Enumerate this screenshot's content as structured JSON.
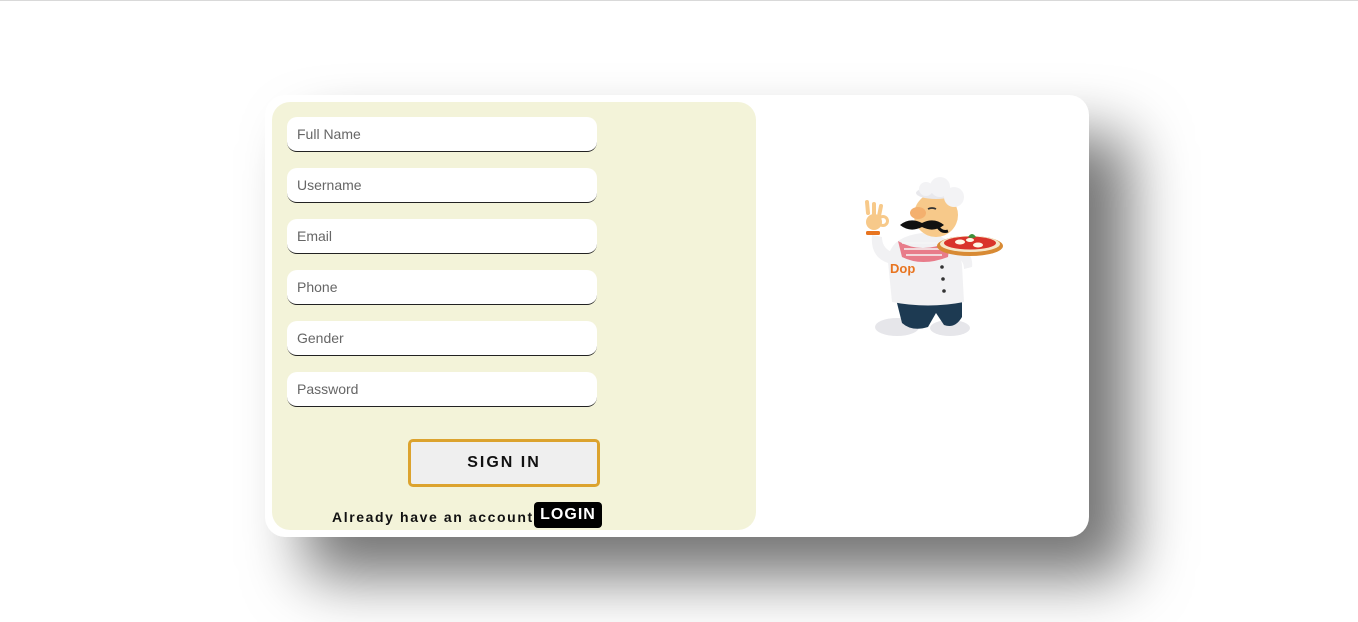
{
  "form": {
    "fields": {
      "full_name": {
        "placeholder": "Full Name",
        "value": ""
      },
      "username": {
        "placeholder": "Username",
        "value": ""
      },
      "email": {
        "placeholder": "Email",
        "value": ""
      },
      "phone": {
        "placeholder": "Phone",
        "value": ""
      },
      "gender": {
        "placeholder": "Gender",
        "value": ""
      },
      "password": {
        "placeholder": "Password",
        "value": ""
      }
    },
    "submit_label": "SIGN IN",
    "already_text": "Already have an account?",
    "login_label": "LOGIN"
  },
  "illustration": {
    "icon": "pizza-chef-illustration",
    "badge_text": "Dop"
  },
  "colors": {
    "panel_bg": "#f3f3d9",
    "button_border": "#dca32e",
    "login_bg": "#000000"
  }
}
